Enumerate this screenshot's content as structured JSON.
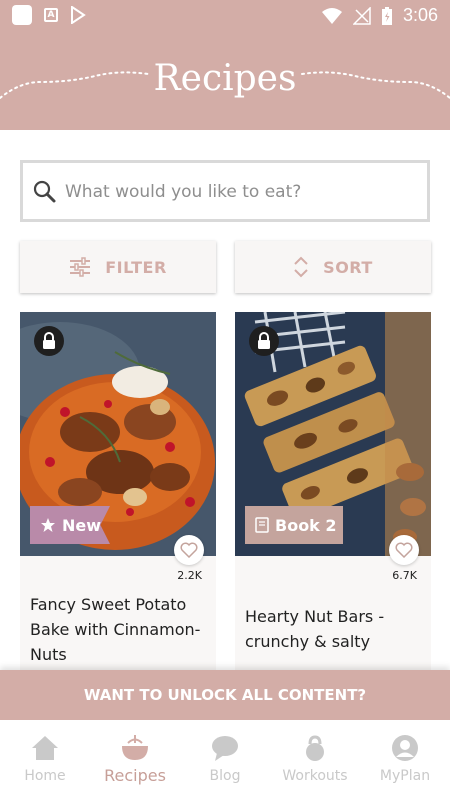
{
  "status_bar": {
    "time": "3:06"
  },
  "header": {
    "title": "Recipes"
  },
  "search": {
    "placeholder": "What would you like to eat?"
  },
  "toolbar": {
    "filter_label": "FILTER",
    "sort_label": "SORT"
  },
  "recipes": [
    {
      "title": "Fancy Sweet Potato Bake with Cinnamon-Nuts",
      "tag": "New",
      "likes": "2.2K",
      "locked": true,
      "tag_color": "#b98aa9"
    },
    {
      "title": "Hearty Nut Bars - crunchy & salty",
      "tag": "Book 2",
      "likes": "6.7K",
      "locked": true,
      "tag_color": "#c4a49d"
    }
  ],
  "unlock_banner": {
    "label": "WANT TO UNLOCK ALL CONTENT?"
  },
  "bottom_nav": {
    "items": [
      {
        "label": "Home",
        "icon": "home-icon"
      },
      {
        "label": "Recipes",
        "icon": "bowl-icon",
        "active": true
      },
      {
        "label": "Blog",
        "icon": "speech-bubble-icon"
      },
      {
        "label": "Workouts",
        "icon": "kettlebell-icon"
      },
      {
        "label": "MyPlan",
        "icon": "profile-icon"
      }
    ]
  },
  "colors": {
    "accent": "#d3ada7",
    "accent_text": "#c79f98",
    "inactive": "#c9c9c9"
  }
}
